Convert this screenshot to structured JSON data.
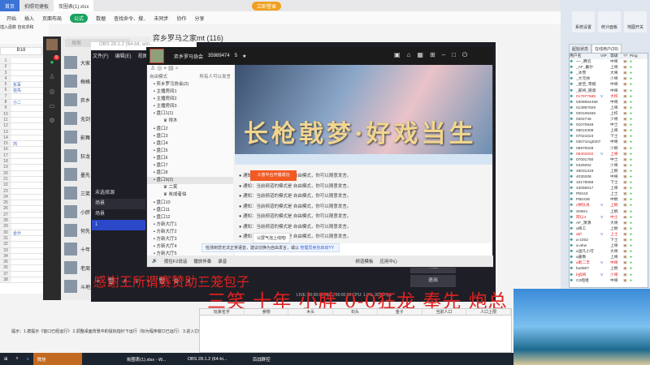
{
  "wps": {
    "tabs": [
      "首页",
      "拍照司捷板",
      "炭圈表(1).xlsx"
    ],
    "ribbon": [
      "开始",
      "插入",
      "页面布局",
      "公式",
      "数据",
      "查找命令、搜..",
      "未同步",
      "协作",
      "分享"
    ],
    "vip": "立即登录",
    "tools": [
      "插入函数",
      "自动求和"
    ],
    "cell_ref": "B18",
    "rows": [
      {
        "n": "1",
        "v": ""
      },
      {
        "n": "2",
        "v": ""
      },
      {
        "n": "3",
        "v": ""
      },
      {
        "n": "4",
        "v": ""
      },
      {
        "n": "5",
        "v": "东军"
      },
      {
        "n": "6",
        "v": "狂先"
      },
      {
        "n": "7",
        "v": ""
      },
      {
        "n": "8",
        "v": "小二"
      },
      {
        "n": "9",
        "v": ""
      },
      {
        "n": "10",
        "v": ""
      },
      {
        "n": "11",
        "v": ""
      },
      {
        "n": "12",
        "v": ""
      },
      {
        "n": "13",
        "v": ""
      },
      {
        "n": "14",
        "v": ""
      },
      {
        "n": "15",
        "v": "鸿"
      },
      {
        "n": "16",
        "v": ""
      },
      {
        "n": "17",
        "v": ""
      },
      {
        "n": "18",
        "v": ""
      },
      {
        "n": "19",
        "v": ""
      },
      {
        "n": "20",
        "v": ""
      },
      {
        "n": "21",
        "v": ""
      },
      {
        "n": "22",
        "v": ""
      },
      {
        "n": "23",
        "v": ""
      },
      {
        "n": "24",
        "v": ""
      },
      {
        "n": "25",
        "v": ""
      },
      {
        "n": "26",
        "v": ""
      },
      {
        "n": "27",
        "v": ""
      },
      {
        "n": "28",
        "v": ""
      },
      {
        "n": "29",
        "v": ""
      },
      {
        "n": "30",
        "v": "合计"
      },
      {
        "n": "31",
        "v": ""
      },
      {
        "n": "32",
        "v": ""
      },
      {
        "n": "33",
        "v": ""
      },
      {
        "n": "34",
        "v": ""
      },
      {
        "n": "35",
        "v": ""
      },
      {
        "n": "36",
        "v": ""
      },
      {
        "n": "37",
        "v": ""
      },
      {
        "n": "38",
        "v": ""
      }
    ]
  },
  "wechat": {
    "search_placeholder": "搜索",
    "chat_title": "弈乡罗马之家mt (116)",
    "chats": [
      "大家",
      "梅格",
      "弈乡",
      "无剑",
      "影舞",
      "狂龙",
      "墨先",
      "三笑",
      "小胖",
      "何先",
      "十年",
      "老周",
      "斗地主群"
    ],
    "badge": "9"
  },
  "obs": {
    "title": "OBS 28.1.2 (64-bit, win...",
    "menu": [
      "文件(F)",
      "编辑(E)",
      "视图(V)"
    ],
    "no_source": "未选择源",
    "scenes_header": "场景",
    "scenes": [
      "场景",
      "1"
    ],
    "controls": [
      "+",
      "🗑",
      "∧",
      "∨",
      "+",
      "🗑",
      "⚙",
      "∧",
      "⋮",
      "⋮"
    ],
    "right_buttons": [
      "设置",
      "退出"
    ],
    "status": "LIVE: 00:00:00  REC: 00:00:00  CPU: 1.0%, 30.00 fps"
  },
  "yy": {
    "channel": "弈乡罗马协会",
    "id": "35989474",
    "users": "5",
    "mode": "自由模式",
    "hint": "所有人可以发言",
    "tree": [
      {
        "t": "弈乡罗马协会(2)",
        "u": false
      },
      {
        "t": "主播房间1",
        "u": false
      },
      {
        "t": "主播房间2",
        "u": false
      },
      {
        "t": "主播房间3",
        "u": false
      },
      {
        "t": "盘口1(1)",
        "u": false
      },
      {
        "t": "得木",
        "u": true
      },
      {
        "t": "盘口2",
        "u": false
      },
      {
        "t": "盘口3",
        "u": false
      },
      {
        "t": "盘口4",
        "u": false
      },
      {
        "t": "盘口5",
        "u": false
      },
      {
        "t": "盘口6",
        "u": false
      },
      {
        "t": "盘口7",
        "u": false
      },
      {
        "t": "盘口8",
        "u": false
      },
      {
        "t": "盘口9(2)",
        "u": false,
        "sel": true
      },
      {
        "t": "二笑",
        "u": true
      },
      {
        "t": "炭成者伯",
        "u": true
      },
      {
        "t": "盘口10",
        "u": false
      },
      {
        "t": "盘口11",
        "u": false
      },
      {
        "t": "盘口12",
        "u": false
      },
      {
        "t": "方新大厅1",
        "u": false
      },
      {
        "t": "方新大厅2",
        "u": false
      },
      {
        "t": "方新大厅3",
        "u": false
      },
      {
        "t": "方新大厅4",
        "u": false
      },
      {
        "t": "方新大厅5",
        "u": false
      }
    ],
    "banner": "长枪戟梦·好戏当生",
    "toast": "斗兽平台开播成功",
    "messages": [
      "通知：当前频道的模式是 自由模式，你可以随意发言。",
      "通知：当前频道的模式是 自由模式，你可以随意发言。",
      "通知：当前频道的模式是 自由模式，你可以随意发言。",
      "通知：当前频道的模式是 自由模式，你可以随意发言。",
      "通知：当前频道的模式是 自由模式，你可以随意发言。",
      "通知：当前频道的模式是 自由模式，你可以随意发言。",
      "通知：当前频道的模式是 自由模式，你可以随意发言。"
    ],
    "bubble": "公屏气泡上线啦!",
    "notice": "检测到您无法正常语音，建议切换为自由发言，或以",
    "notice_link": "管理员身份启动YY",
    "bottom": [
      "按住F2说话",
      "播放伴奏",
      "录音",
      "频道模板",
      "应用中心"
    ]
  },
  "captions": {
    "thanks": "感谢王所谓赛赞助三笼包子",
    "names": "三笑 十年 小胖 0-0狂龙 奉先 炮总"
  },
  "right_panel": {
    "buttons": [
      "系统设置",
      "统计面板",
      "地图开关"
    ],
    "tabs": [
      "起始状态",
      "在线用户(39)"
    ],
    "headers": [
      "用户名",
      "VIP",
      "等级",
      "??",
      "Ping"
    ],
    "users": [
      [
        "一-_腾云",
        "",
        "中将",
        "",
        ""
      ],
      [
        "_AF_戴尔",
        "",
        "上将",
        "",
        ""
      ],
      [
        "_冰雪",
        "",
        "大将",
        "",
        ""
      ],
      [
        "_大元帅",
        "",
        "少将",
        "",
        ""
      ],
      [
        "_星空_零痕",
        "",
        "中将",
        "",
        ""
      ],
      [
        "_部将_随意",
        "",
        "中将",
        "",
        ""
      ],
      [
        "017977688",
        "V",
        "大校",
        "",
        "red"
      ],
      [
        "0308654458",
        "",
        "中将",
        "",
        ""
      ],
      [
        "013997929",
        "",
        "上将",
        "",
        ""
      ],
      [
        "020106455",
        "",
        "上校",
        "",
        ""
      ],
      [
        "0302746",
        "",
        "少将",
        "",
        ""
      ],
      [
        "01070948",
        "",
        "中士",
        "",
        ""
      ],
      [
        "08010308",
        "",
        "上将",
        "",
        ""
      ],
      [
        "07021023",
        "",
        "下士",
        "",
        ""
      ],
      [
        "03071ing0307",
        "",
        "中将",
        "",
        ""
      ],
      [
        "08970028",
        "",
        "少尉",
        "",
        ""
      ],
      [
        "08402002",
        "V",
        "上将",
        "",
        "red"
      ],
      [
        "07001750",
        "",
        "中士",
        "",
        ""
      ],
      [
        "0425002",
        "",
        "少将",
        "",
        ""
      ],
      [
        "48031319",
        "",
        "上尉",
        "",
        ""
      ],
      [
        "4030208",
        "",
        "中将",
        "",
        ""
      ],
      [
        "10179068",
        "",
        "下士",
        "",
        ""
      ],
      [
        "43056617",
        "",
        "上将",
        "",
        ""
      ],
      [
        "PE043",
        "",
        "上士",
        "",
        ""
      ],
      [
        "PB0436",
        "",
        "中尉",
        "",
        ""
      ],
      [
        "z拼队员",
        "V",
        "上尉",
        "",
        "red"
      ],
      [
        "S0604",
        "",
        "上尉",
        "",
        ""
      ],
      [
        "阿以4",
        "V",
        "中士",
        "",
        "red"
      ],
      [
        "AF_演演",
        "",
        "大将",
        "",
        ""
      ],
      [
        "a将工",
        "",
        "上尉",
        "",
        ""
      ],
      [
        "abf",
        "V",
        "上士",
        "",
        "red"
      ],
      [
        "a-1002",
        "",
        "下士",
        "",
        ""
      ],
      [
        "a-ahw",
        "",
        "上将",
        "",
        ""
      ],
      [
        "a温凡小可",
        "",
        "大将",
        "",
        ""
      ],
      [
        "a嘉数",
        "",
        "上将",
        "",
        ""
      ],
      [
        "a刺二丰",
        "V",
        "中将",
        "",
        "red"
      ],
      [
        "bu0807",
        "",
        "上尉",
        "",
        ""
      ],
      [
        "b战将",
        "V",
        "少将",
        "",
        "red"
      ],
      [
        "C0组组",
        "",
        "中将",
        "",
        ""
      ]
    ]
  },
  "bottom_grid": {
    "headers": [
      "玩家名字",
      "食物",
      "木头",
      "石头",
      "金子",
      "当前人口",
      "人口上限"
    ],
    "tip": "提示：1.按提示《窗口已经运行》  2.调整桌面背景中的鼠标指针下运行（标为程序窗口已运行）  3.进入它吧"
  },
  "taskbar": [
    "微信",
    "炭圈表(1).xlsx - W...",
    "OBS 28.1.2 (64-bi...",
    "百战群控"
  ]
}
